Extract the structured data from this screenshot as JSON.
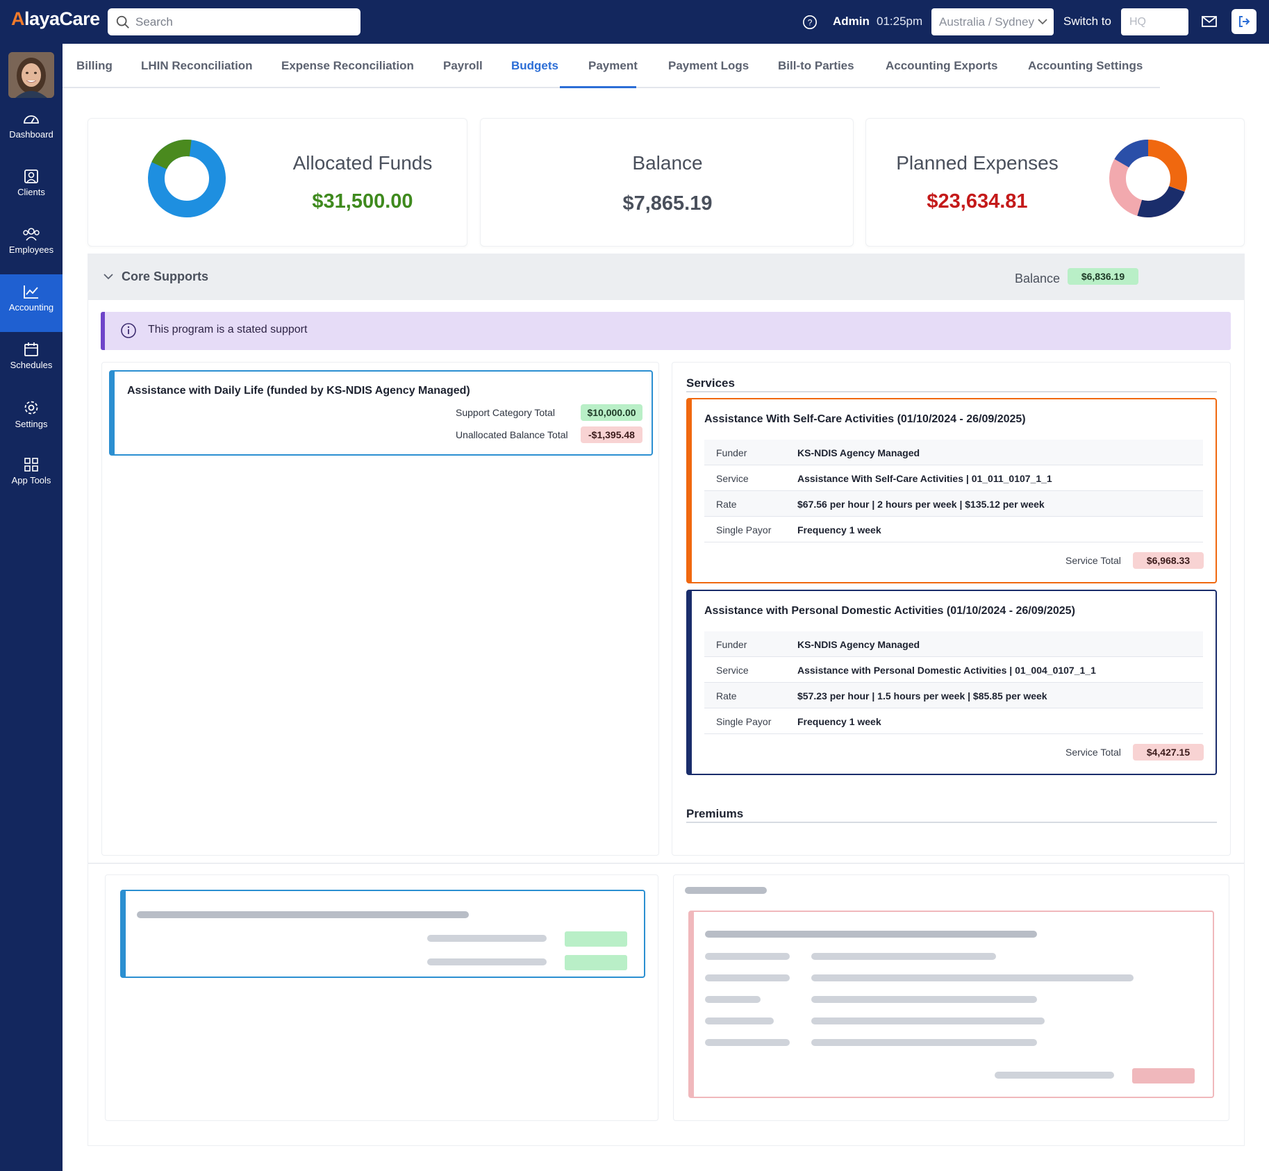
{
  "app": {
    "logo": "AlayaCare"
  },
  "topbar": {
    "search_placeholder": "Search",
    "user": "Admin",
    "time": "01:25pm",
    "region": "Australia / Sydney",
    "switch_label": "Switch to",
    "switch_placeholder": "HQ"
  },
  "sidebar": {
    "items": [
      {
        "label": "Dashboard",
        "icon": "dashboard-gauge-icon"
      },
      {
        "label": "Clients",
        "icon": "clients-icon"
      },
      {
        "label": "Employees",
        "icon": "employees-icon"
      },
      {
        "label": "Accounting",
        "icon": "accounting-chart-icon",
        "active": true
      },
      {
        "label": "Schedules",
        "icon": "calendar-icon"
      },
      {
        "label": "Settings",
        "icon": "gear-icon"
      },
      {
        "label": "App Tools",
        "icon": "grid-icon"
      }
    ]
  },
  "tabs": [
    "Billing",
    "LHIN Reconciliation",
    "Expense Reconciliation",
    "Payroll",
    "Budgets",
    "Payment",
    "Payment Logs",
    "Bill-to Parties",
    "Accounting Exports",
    "Accounting Settings"
  ],
  "active_tab": "Budgets",
  "summary": {
    "allocated": {
      "title": "Allocated Funds",
      "value": "$31,500.00"
    },
    "balance": {
      "title": "Balance",
      "value": "$7,865.19"
    },
    "planned": {
      "title": "Planned Expenses",
      "value": "$23,634.81"
    }
  },
  "colors": {
    "accent": "#2c6ed6",
    "navy": "#13275e",
    "green_value": "#3f8a1e",
    "red_value": "#c41a1a",
    "donut_blue": "#1e8fe0",
    "donut_green": "#4a8a1e",
    "donut_orange": "#f0680f",
    "donut_navy": "#1a2d6b",
    "donut_pink": "#f2a9ae",
    "donut_royal": "#2a4fa8"
  },
  "core": {
    "title": "Core Supports",
    "balance_label": "Balance",
    "balance_value": "$6,836.19",
    "notice": "This program is a stated support"
  },
  "category": {
    "title": "Assistance with Daily Life (funded by KS-NDIS Agency Managed)",
    "total_label": "Support Category Total",
    "total_value": "$10,000.00",
    "unallocated_label": "Unallocated Balance Total",
    "unallocated_value": "-$1,395.48"
  },
  "services_title": "Services",
  "premiums_title": "Premiums",
  "services": [
    {
      "title": "Assistance With Self-Care Activities (01/10/2024 - 26/09/2025)",
      "rows": [
        {
          "key": "Funder",
          "value": "KS-NDIS Agency Managed"
        },
        {
          "key": "Service",
          "value": "Assistance With Self-Care Activities | 01_011_0107_1_1"
        },
        {
          "key": "Rate",
          "value": "$67.56 per hour | 2 hours per week | $135.12 per week"
        },
        {
          "key": "Single Payor",
          "value": "Frequency 1 week"
        }
      ],
      "total_label": "Service Total",
      "total_value": "$6,968.33"
    },
    {
      "title": "Assistance with Personal Domestic Activities (01/10/2024 - 26/09/2025)",
      "rows": [
        {
          "key": "Funder",
          "value": "KS-NDIS Agency Managed"
        },
        {
          "key": "Service",
          "value": "Assistance with Personal Domestic Activities | 01_004_0107_1_1"
        },
        {
          "key": "Rate",
          "value": "$57.23 per hour | 1.5 hours per week | $85.85 per week"
        },
        {
          "key": "Single Payor",
          "value": "Frequency 1 week"
        }
      ],
      "total_label": "Service Total",
      "total_value": "$4,427.15"
    }
  ]
}
